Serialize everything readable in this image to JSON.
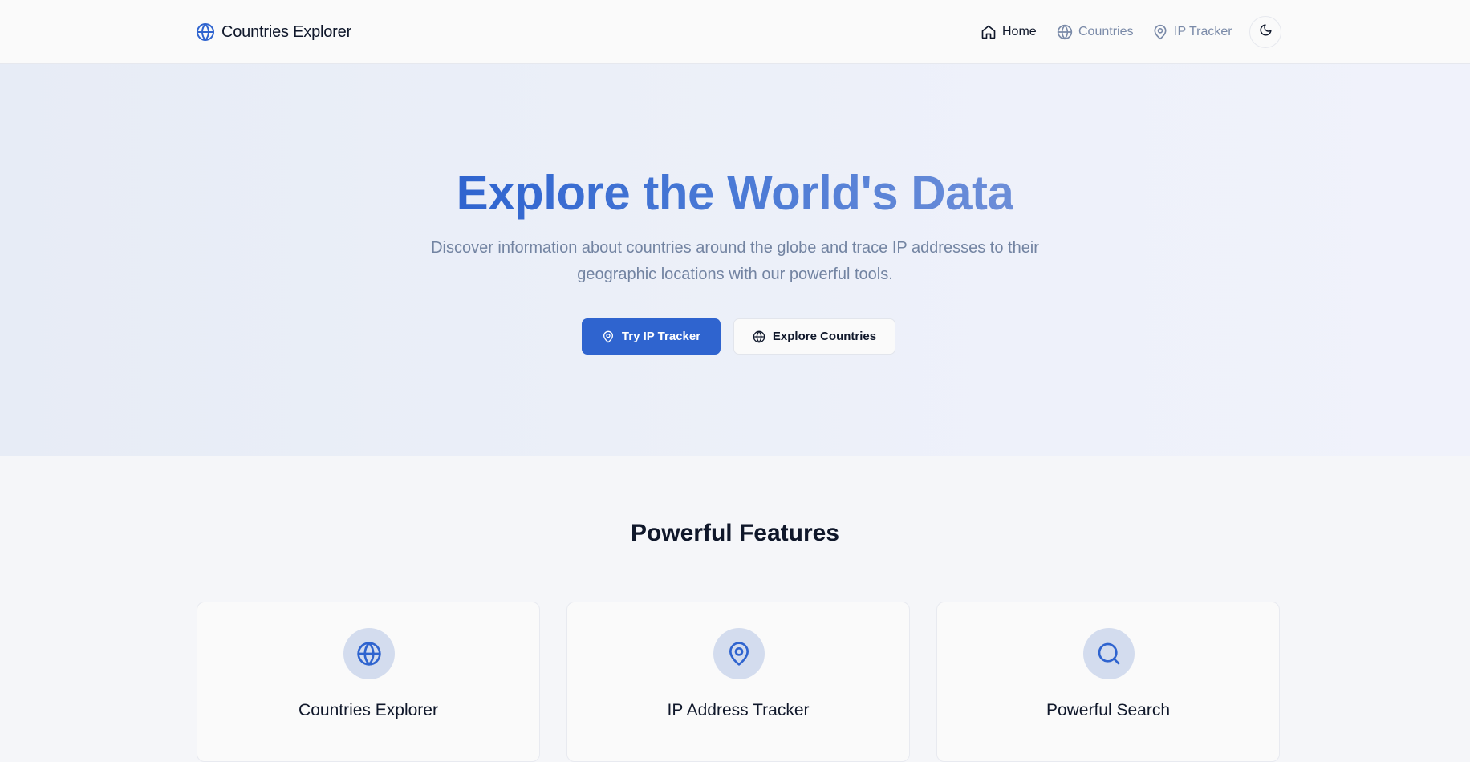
{
  "header": {
    "brand_name": "Countries Explorer",
    "brand_icon": "globe-icon",
    "nav": [
      {
        "label": "Home",
        "icon": "home-icon",
        "active": true
      },
      {
        "label": "Countries",
        "icon": "globe-icon",
        "active": false
      },
      {
        "label": "IP Tracker",
        "icon": "map-pin-icon",
        "active": false
      }
    ],
    "theme_toggle_icon": "moon-icon"
  },
  "hero": {
    "title": "Explore the World's Data",
    "subtitle": "Discover information about countries around the globe and trace IP addresses to their geographic locations with our powerful tools.",
    "primary_button": {
      "label": "Try IP Tracker",
      "icon": "map-pin-icon"
    },
    "secondary_button": {
      "label": "Explore Countries",
      "icon": "globe-icon"
    }
  },
  "features": {
    "title": "Powerful Features",
    "cards": [
      {
        "title": "Countries Explorer",
        "icon": "globe-icon"
      },
      {
        "title": "IP Address Tracker",
        "icon": "map-pin-icon"
      },
      {
        "title": "Powerful Search",
        "icon": "search-icon"
      }
    ]
  },
  "colors": {
    "accent": "#2f64cf",
    "icon_circle": "#d3dcee",
    "muted_text": "#7384a2",
    "background": "#f5f6f9"
  }
}
